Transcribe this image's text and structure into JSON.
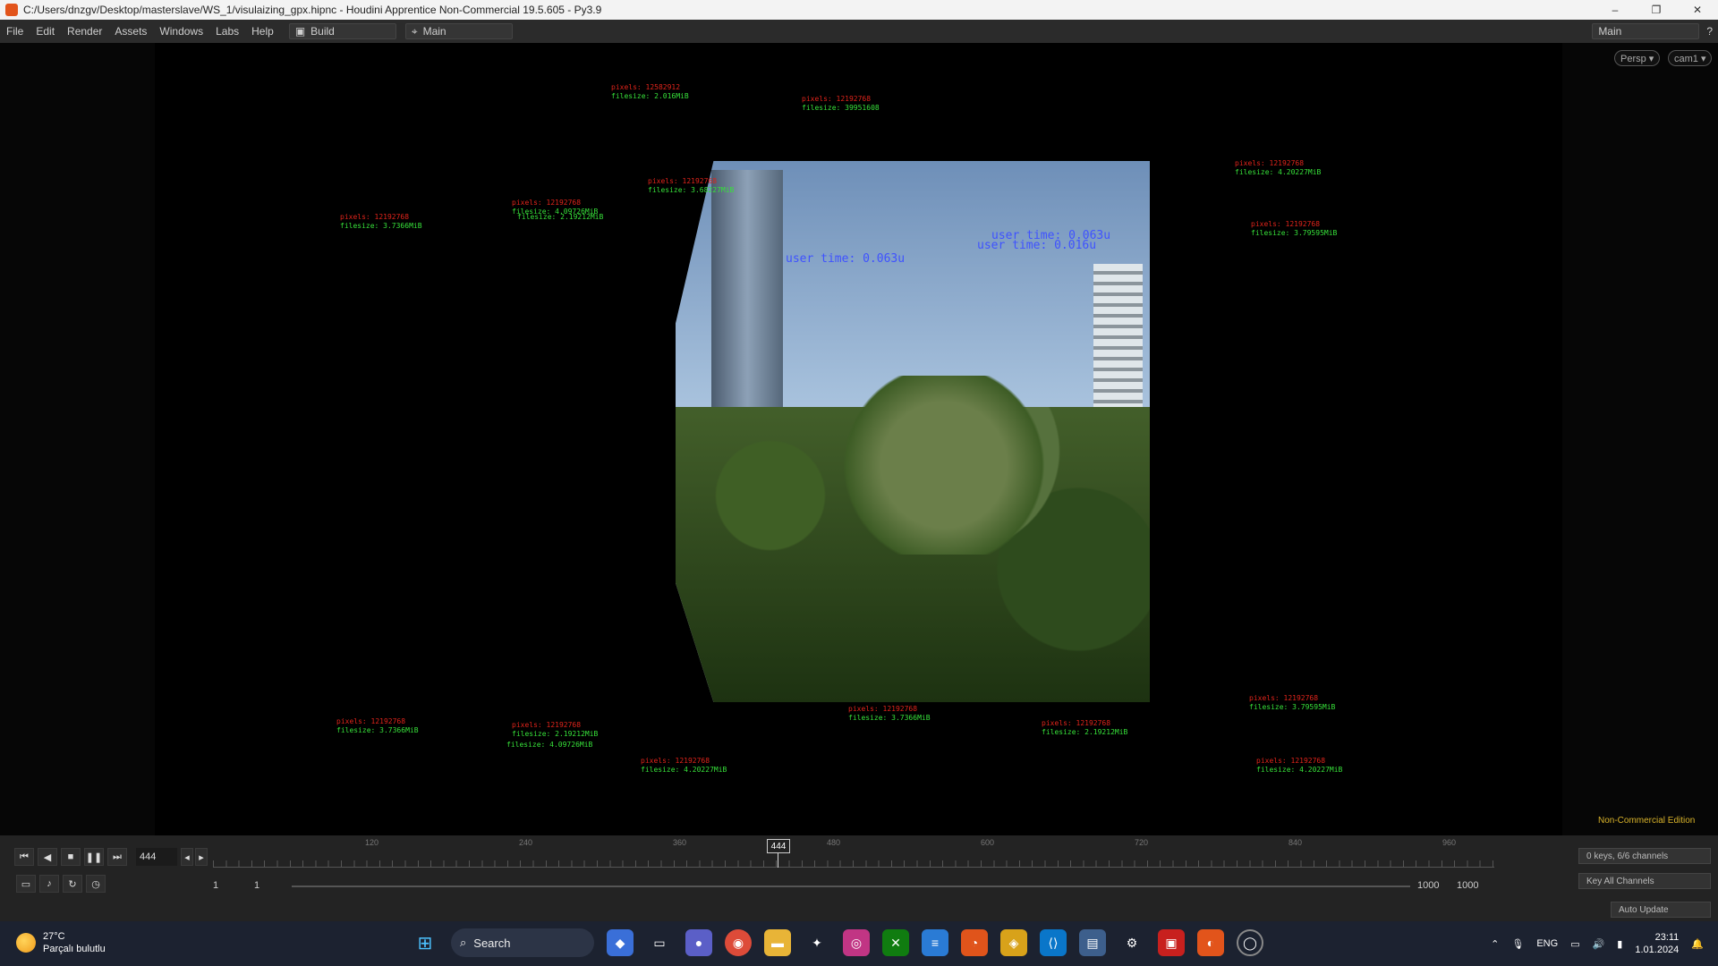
{
  "window": {
    "title": "C:/Users/dnzgv/Desktop/masterslave/WS_1/visulaizing_gpx.hipnc - Houdini Apprentice Non-Commercial 19.5.605 - Py3.9",
    "minimize": "–",
    "maximize": "❐",
    "close": "✕"
  },
  "menu": {
    "items": [
      "File",
      "Edit",
      "Render",
      "Assets",
      "Windows",
      "Labs",
      "Help"
    ],
    "desktop": "Build",
    "viewset": "Main",
    "right_desk": "Main"
  },
  "viewport": {
    "persp": "Persp ▾",
    "cam": "cam1 ▾",
    "non_commercial": "Non-Commercial Edition"
  },
  "overlays": [
    {
      "pixels": "pixels: 12582912",
      "filesize": "filesize: 2.016MiB"
    },
    {
      "pixels": "pixels: 12192768",
      "filesize": "filesize: 39951608"
    },
    {
      "pixels": "pixels: 12192768",
      "filesize": "filesize: 4.20227MiB"
    },
    {
      "pixels": "pixels: 12192768",
      "filesize": "filesize: 3.7366MiB"
    },
    {
      "pixels": "pixels: 12192768",
      "filesize": "filesize: 4.09726MiB"
    },
    {
      "pixels": "pixels: 12192768",
      "filesize": "filesize: 2.19212MiB"
    },
    {
      "pixels": "pixels: 12192768",
      "filesize": "filesize: 3.68227MiB"
    },
    {
      "pixels": "pixels: 12192768",
      "filesize": "filesize: 3.79595MiB"
    },
    {
      "pixels": "pixels: 12192768",
      "filesize": "filesize: 3.7366MiB"
    },
    {
      "pixels": "pixels: 12192768",
      "filesize": "filesize: 2.19212MiB"
    },
    {
      "pixels": "pixels: 12192768",
      "filesize": "filesize: 4.09726MiB"
    },
    {
      "pixels": "pixels: 12192768",
      "filesize": "filesize: 4.20227MiB"
    },
    {
      "pixels": "pixels: 12192768",
      "filesize": "filesize: 3.7366MiB"
    },
    {
      "pixels": "pixels: 12192768",
      "filesize": "filesize: 3.79595MiB"
    },
    {
      "pixels": "pixels: 12192768",
      "filesize": "filesize: 4.20227MiB"
    },
    {
      "pixels": "pixels: 12192768",
      "filesize": "filesize: 2.19212MiB"
    }
  ],
  "user_times": {
    "bright1": "user time: 0.063u",
    "bright2": "user time: 0.016u",
    "bright3": "user time: 0.063u"
  },
  "timeline": {
    "frame": "444",
    "cursor": "444",
    "ticks": [
      "120",
      "240",
      "360",
      "480",
      "600",
      "720",
      "840",
      "960"
    ],
    "start1": "1",
    "start2": "1",
    "end1": "1000",
    "end2": "1000",
    "keys": "0 keys, 6/6 channels",
    "key_all": "Key All Channels",
    "auto_update": "Auto Update"
  },
  "taskbar": {
    "temp": "27°C",
    "weather": "Parçalı bulutlu",
    "search": "Search",
    "lang": "ENG",
    "time": "23:11",
    "date": "1.01.2024"
  }
}
